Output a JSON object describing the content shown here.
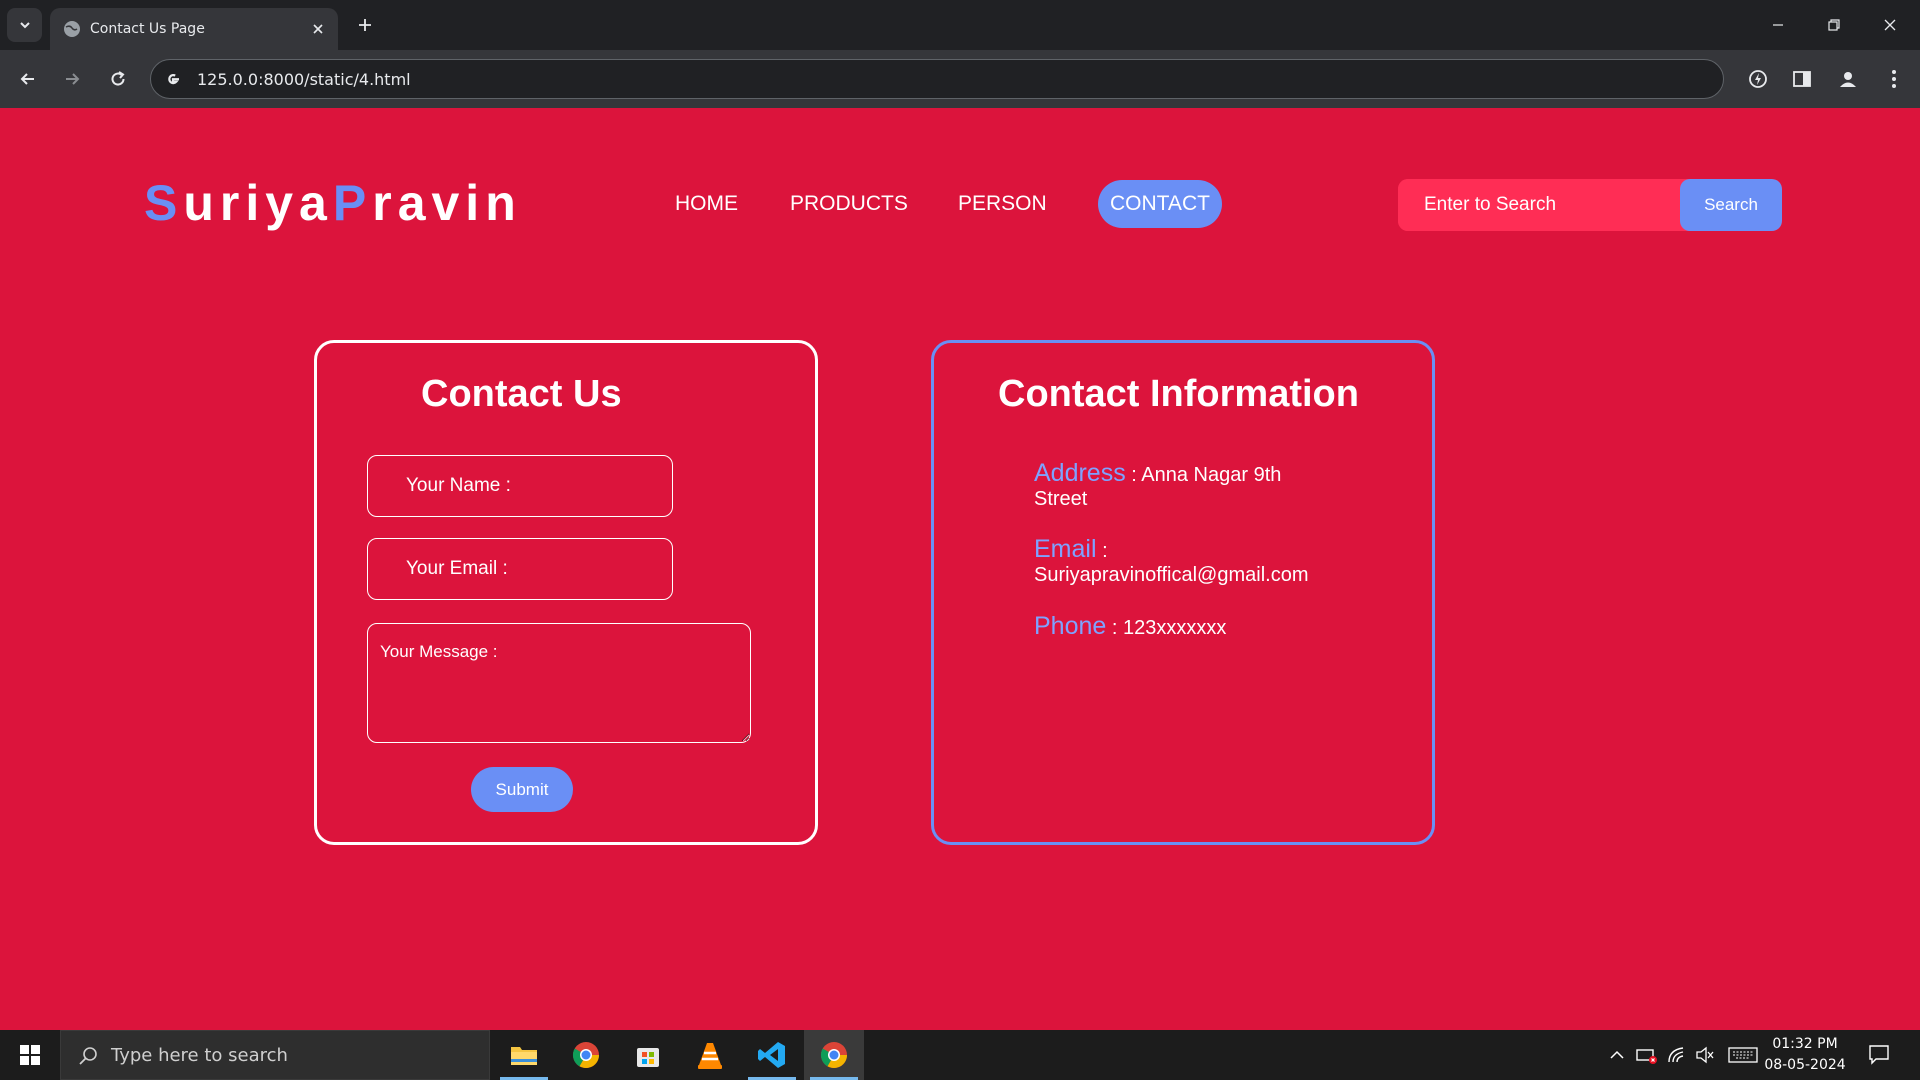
{
  "browser": {
    "tab_title": "Contact Us Page",
    "url": "125.0.0:8000/static/4.html"
  },
  "site": {
    "logo": {
      "first_initial": "S",
      "first_rest": "uriya",
      "second_initial": "P",
      "second_rest": "ravin"
    },
    "nav": [
      "HOME",
      "PRODUCTS",
      "PERSON",
      "CONTACT"
    ],
    "active_nav": "CONTACT",
    "search": {
      "placeholder": "Enter to Search",
      "button": "Search"
    }
  },
  "contact_form": {
    "title": "Contact Us",
    "name_placeholder": "Your Name :",
    "email_placeholder": "Your Email :",
    "message_placeholder": "Your Message :",
    "submit_label": "Submit"
  },
  "contact_info": {
    "title": "Contact Information",
    "address_label": "Address",
    "address_value": ": Anna Nagar 9th Street",
    "email_label": "Email",
    "email_value": "Suriyapravinoffical@gmail.com",
    "phone_label": "Phone",
    "phone_value": ": 123xxxxxxx"
  },
  "taskbar": {
    "search_placeholder": "Type here to search",
    "time": "01:32 PM",
    "date": "08-05-2024"
  },
  "colors": {
    "page_background": "#dc143c",
    "accent": "#6a8ff5",
    "search_field": "#ff2d55"
  }
}
